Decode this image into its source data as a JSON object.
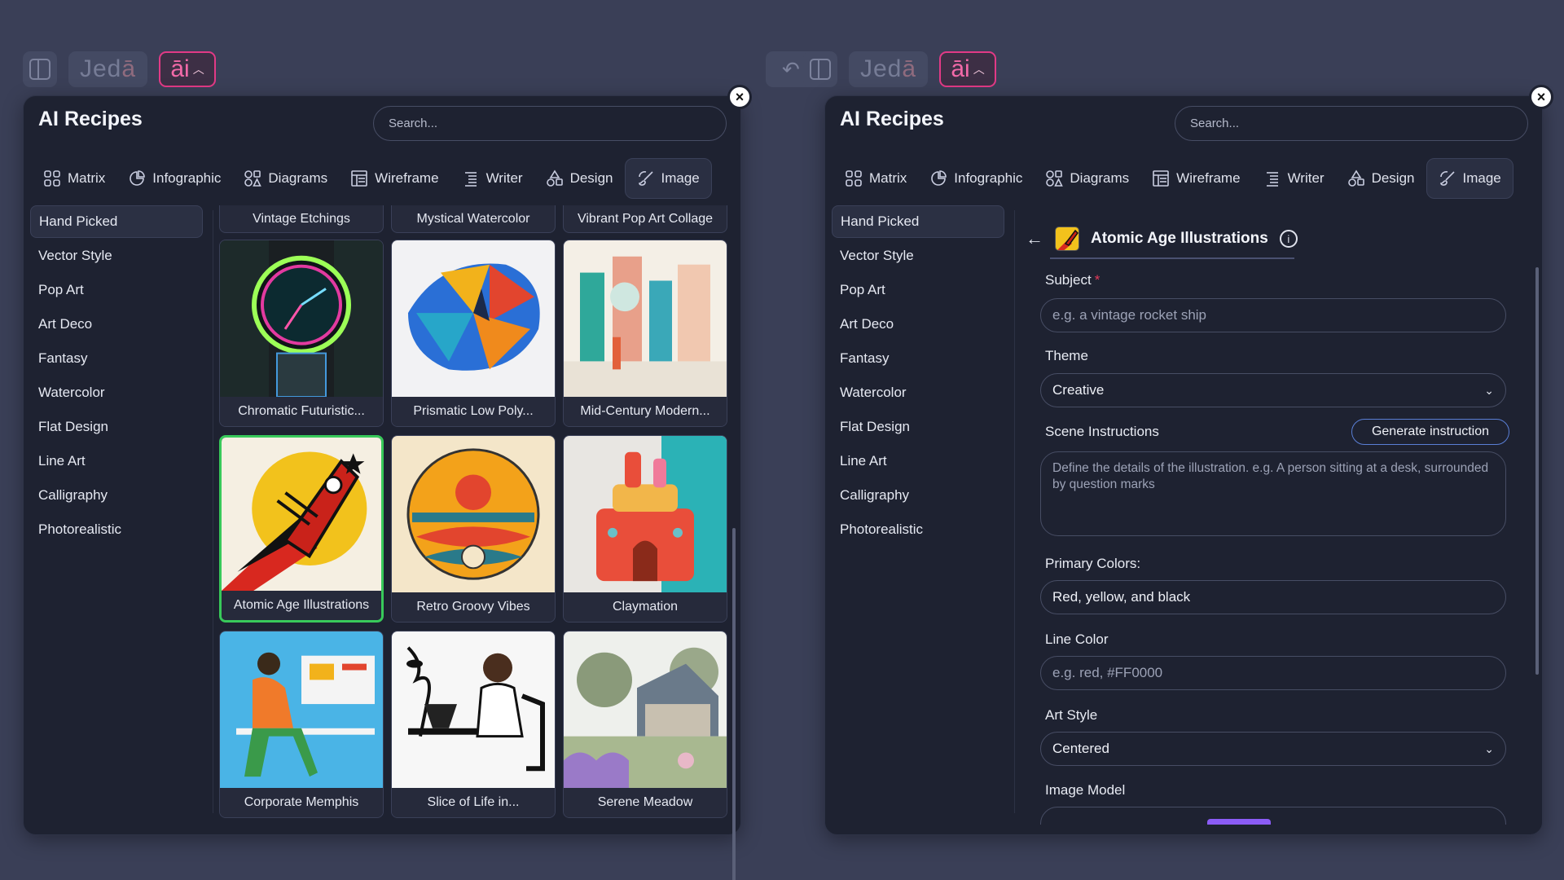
{
  "toolbar": {
    "brand_main": "Jed",
    "brand_accent": "ā",
    "ai_label": "āi",
    "ai_caret": "^"
  },
  "recipes_panel": {
    "title": "AI Recipes",
    "search_placeholder": "Search...",
    "close": "×",
    "tabs": [
      {
        "label": "Matrix",
        "icon": "grid-icon"
      },
      {
        "label": "Infographic",
        "icon": "pie-chart-icon"
      },
      {
        "label": "Diagrams",
        "icon": "shapes-icon"
      },
      {
        "label": "Wireframe",
        "icon": "layout-icon"
      },
      {
        "label": "Writer",
        "icon": "list-icon"
      },
      {
        "label": "Design",
        "icon": "design-shapes-icon"
      },
      {
        "label": "Image",
        "icon": "brush-icon"
      }
    ],
    "sidebar": [
      "Hand Picked",
      "Vector Style",
      "Pop Art",
      "Art Deco",
      "Fantasy",
      "Watercolor",
      "Flat Design",
      "Line Art",
      "Calligraphy",
      "Photorealistic"
    ],
    "top_row": [
      "Vintage Etchings",
      "Mystical Watercolor",
      "Vibrant Pop Art Collage"
    ],
    "cards": [
      "Chromatic Futuristic...",
      "Prismatic Low Poly...",
      "Mid-Century Modern...",
      "Atomic Age Illustrations",
      "Retro Groovy Vibes",
      "Claymation",
      "Corporate Memphis",
      "Slice of Life in...",
      "Serene Meadow"
    ]
  },
  "form": {
    "back": "←",
    "recipe_title": "Atomic Age Illustrations",
    "info": "i",
    "subject_label": "Subject",
    "required_mark": "*",
    "subject_placeholder": "e.g. a vintage rocket ship",
    "theme_label": "Theme",
    "theme_value": "Creative",
    "scene_label": "Scene Instructions",
    "generate_button": "Generate instruction",
    "scene_placeholder": "Define the details of the illustration. e.g. A person sitting at a desk, surrounded by question marks",
    "primary_colors_label": "Primary Colors:",
    "primary_colors_value": "Red, yellow, and black",
    "line_color_label": "Line Color",
    "line_color_placeholder": "e.g. red, #FF0000",
    "art_style_label": "Art Style",
    "art_style_value": "Centered",
    "image_model_label": "Image Model"
  },
  "colors": {
    "background": "#3a3f57",
    "panel": "#1e2231",
    "accent_pink": "#e23a86",
    "selected_green": "#38c95a",
    "button_border_blue": "#5a7fd6"
  }
}
